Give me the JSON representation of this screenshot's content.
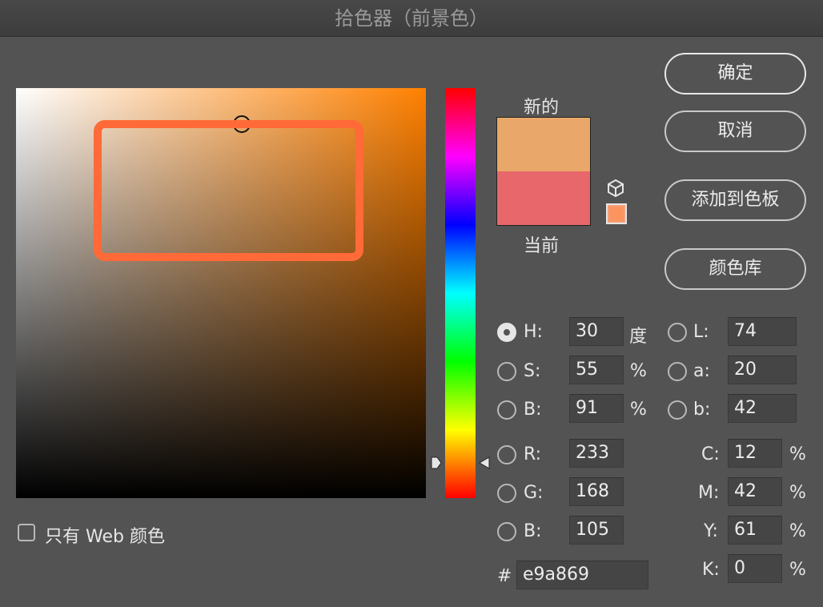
{
  "window": {
    "title": "拾色器（前景色）"
  },
  "preview": {
    "new_label": "新的",
    "current_label": "当前",
    "new_color": "#e9a869",
    "current_color": "#e8676a"
  },
  "buttons": {
    "ok": "确定",
    "cancel": "取消",
    "add_to_swatches": "添加到色板",
    "color_libraries": "颜色库"
  },
  "hsb": {
    "h": {
      "label": "H:",
      "value": "30",
      "unit": "度"
    },
    "s": {
      "label": "S:",
      "value": "55",
      "unit": "%"
    },
    "b": {
      "label": "B:",
      "value": "91",
      "unit": "%"
    }
  },
  "lab": {
    "l": {
      "label": "L:",
      "value": "74"
    },
    "a": {
      "label": "a:",
      "value": "20"
    },
    "b": {
      "label": "b:",
      "value": "42"
    }
  },
  "rgb": {
    "r": {
      "label": "R:",
      "value": "233"
    },
    "g": {
      "label": "G:",
      "value": "168"
    },
    "b": {
      "label": "B:",
      "value": "105"
    }
  },
  "cmyk": {
    "c": {
      "label": "C:",
      "value": "12",
      "unit": "%"
    },
    "m": {
      "label": "M:",
      "value": "42",
      "unit": "%"
    },
    "y": {
      "label": "Y:",
      "value": "61",
      "unit": "%"
    },
    "k": {
      "label": "K:",
      "value": "0",
      "unit": "%"
    }
  },
  "hex": {
    "label": "#",
    "value": "e9a869"
  },
  "web_only": {
    "label": "只有 Web 颜色",
    "checked": false
  },
  "selected_mode": "H",
  "hue_color": "#ff8000",
  "highlight_color": "#ff6a38"
}
